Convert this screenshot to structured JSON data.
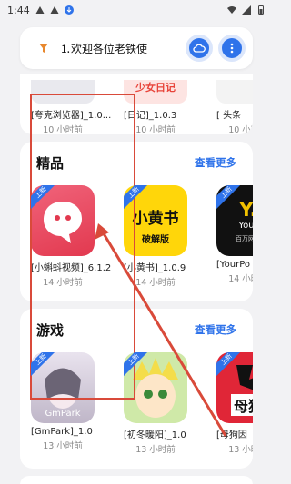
{
  "status_bar": {
    "time": "1:44"
  },
  "header": {
    "marquee_text": "⒈欢迎各位老铁使"
  },
  "top_row": {
    "apps": [
      {
        "name": "[夸克浏览器]_1.0...",
        "time": "10 小时前",
        "banner": ""
      },
      {
        "name": "[日记]_1.0.3",
        "time": "10 小时前",
        "banner": "少女日记"
      },
      {
        "name": "[ 头条",
        "time": "10 小时前",
        "banner": ""
      }
    ]
  },
  "sections": [
    {
      "title": "精品",
      "more": "查看更多",
      "apps": [
        {
          "name": "[小蝌蚪视频]_6.1.2",
          "time": "14 小时前",
          "badge": "上新",
          "icon_text": ""
        },
        {
          "name": "[小黄书]_1.0.9",
          "time": "14 小时前",
          "badge": "上新",
          "icon_text": "小黄书",
          "icon_sub": "破解版"
        },
        {
          "name": "[YourPo",
          "time": "14 小时前",
          "badge": "上新",
          "icon_text": "Y.",
          "icon_sub": "Your",
          "icon_foot": "百万网黄"
        }
      ]
    },
    {
      "title": "游戏",
      "more": "查看更多",
      "apps": [
        {
          "name": "[GmPark]_1.0",
          "time": "13 小时前",
          "badge": "上新",
          "icon_text": "GmPark"
        },
        {
          "name": "[初冬暖阳]_1.0",
          "time": "13 小时前",
          "badge": "上新",
          "icon_text": ""
        },
        {
          "name": "[母狗因",
          "time": "13 小时前",
          "badge": "上新",
          "icon_text": "母狗"
        }
      ]
    }
  ],
  "colors": {
    "accent": "#2f73ea",
    "annotation": "#d94a3a"
  }
}
